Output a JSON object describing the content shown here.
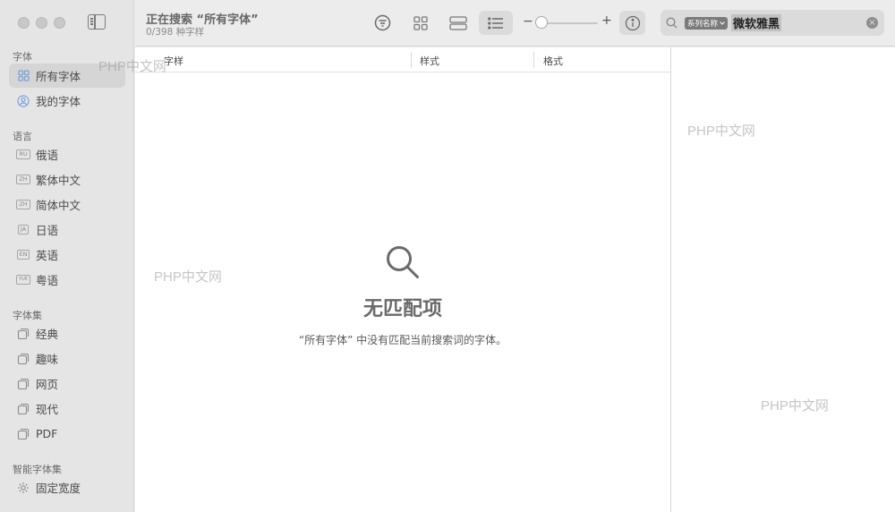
{
  "sidebar": {
    "sections": {
      "fonts": "字体",
      "languages": "语言",
      "collections": "字体集",
      "smart": "智能字体集"
    },
    "font_items": [
      {
        "label": "所有字体",
        "icon": "grid-icon",
        "active": true
      },
      {
        "label": "我的字体",
        "icon": "user-circle-icon",
        "active": false
      }
    ],
    "language_items": [
      {
        "label": "俄语",
        "badge": "RU"
      },
      {
        "label": "繁体中文",
        "badge": "ZH"
      },
      {
        "label": "简体中文",
        "badge": "ZH"
      },
      {
        "label": "日语",
        "badge": "JA"
      },
      {
        "label": "英语",
        "badge": "EN"
      },
      {
        "label": "粤语",
        "badge": "YUE"
      }
    ],
    "collection_items": [
      {
        "label": "经典"
      },
      {
        "label": "趣味"
      },
      {
        "label": "网页"
      },
      {
        "label": "现代"
      },
      {
        "label": "PDF"
      }
    ],
    "smart_items": [
      {
        "label": "固定宽度",
        "icon": "gear-icon"
      }
    ]
  },
  "toolbar": {
    "title": "正在搜索 “所有字体”",
    "subtitle": "0/398 种字样",
    "zoom_minus": "−",
    "zoom_plus": "+",
    "slider_value": 0
  },
  "search": {
    "token": "系列名称",
    "query": "微软雅黑"
  },
  "table": {
    "columns": [
      "字样",
      "样式",
      "格式"
    ]
  },
  "empty_state": {
    "title": "无匹配项",
    "message": "“所有字体” 中没有匹配当前搜索词的字体。"
  },
  "watermarks": [
    "PHP中文网",
    "PHP中文网",
    "PHP中文网",
    "PHP中文网"
  ],
  "colors": {
    "sidebar_bg": "#e6e5e6",
    "accent_icon": "#7ba3d8",
    "content_bg": "#ffffff"
  }
}
